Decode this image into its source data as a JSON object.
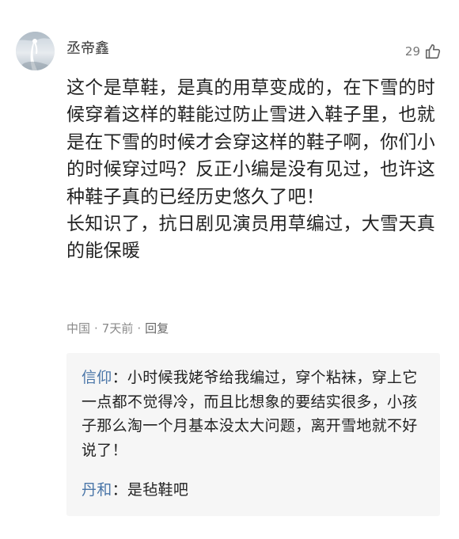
{
  "comment": {
    "username": "丞帝鑫",
    "like_count": "29",
    "body_lines": [
      "这个是草鞋，是真的用草变成的，在下雪的时候穿着这样的鞋能过防止雪进入鞋子里，也就是在下雪的时候才会穿这样的鞋子啊，你们小的时候穿过吗？反正小编是没有见过，也许这种鞋子真的已经历史悠久了吧！",
      "长知识了，抗日剧见演员用草编过，大雪天真的能保暖"
    ],
    "meta": {
      "location": "中国",
      "separator": "·",
      "time": "7天前",
      "reply_label": "回复"
    }
  },
  "replies": [
    {
      "author": "信仰",
      "colon": "：",
      "text": "小时候我姥爷给我编过，穿个粘袜，穿上它一点都不觉得冷，而且比想象的要结实很多，小孩子那么淘一个月基本没太大问题，离开雪地就不好说了！"
    },
    {
      "author": "丹和",
      "colon": "：",
      "text": "是毡鞋吧"
    }
  ],
  "colors": {
    "author_link": "#4a76a8",
    "reply_background": "#f6f6f6",
    "meta_text": "#8a8a8a"
  },
  "icons": {
    "like": "thumbs-up-outline-icon"
  }
}
